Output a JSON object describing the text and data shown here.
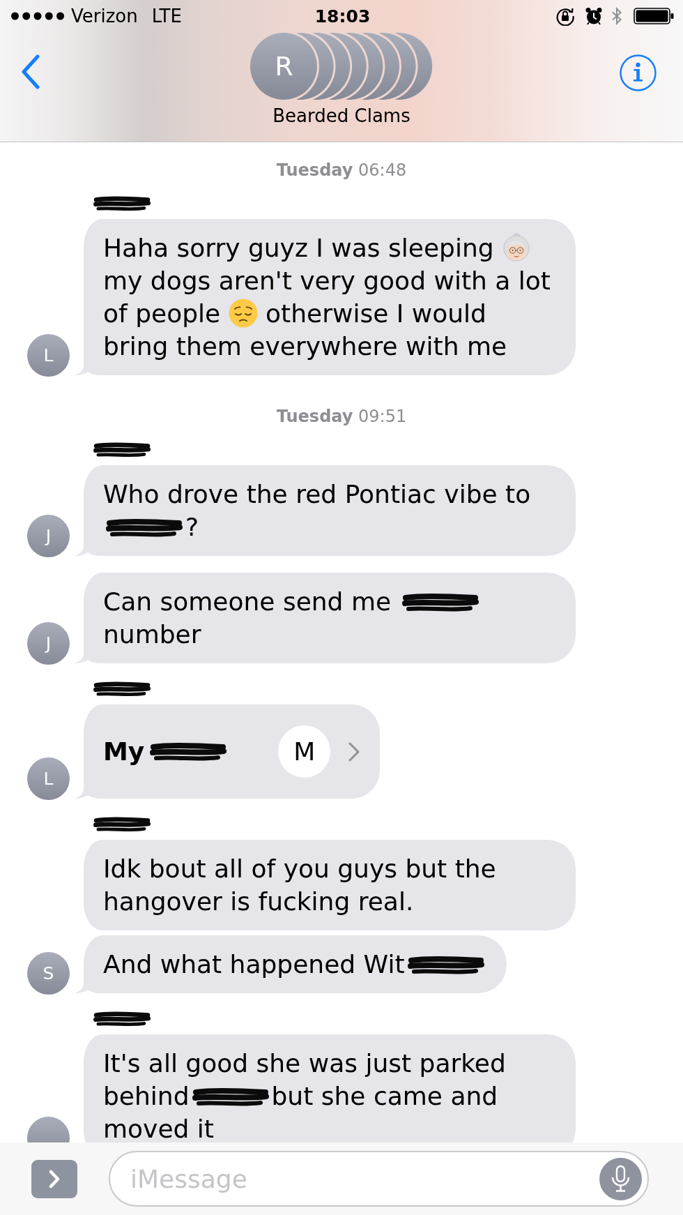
{
  "status_bar": {
    "carrier": "Verizon",
    "network": "LTE",
    "time": "18:03"
  },
  "header": {
    "avatars": [
      {
        "kind": "initial",
        "initial": "R"
      },
      {
        "kind": "blank"
      },
      {
        "kind": "blank"
      },
      {
        "kind": "blank"
      },
      {
        "kind": "blank"
      },
      {
        "kind": "blank"
      },
      {
        "kind": "blank"
      },
      {
        "kind": "blank"
      }
    ],
    "title": "Bearded Clams"
  },
  "thread": [
    {
      "kind": "timestamp",
      "text": "**Tuesday** 06:48"
    },
    {
      "kind": "group",
      "sender_redacted": true,
      "avatar": "L",
      "messages": [
        {
          "kind": "text",
          "tail": true,
          "parts": [
            {
              "kind": "text",
              "text": "Haha sorry guyz I was sleeping "
            },
            {
              "kind": "grandma"
            },
            {
              "kind": "text",
              "text": " my dogs aren't very good with a lot of people "
            },
            {
              "kind": "pensive"
            },
            {
              "kind": "text",
              "text": " otherwise I would bring them everywhere with me"
            }
          ]
        }
      ]
    },
    {
      "kind": "timestamp",
      "text": "**Tuesday** 09:51"
    },
    {
      "kind": "group",
      "sender_redacted": true,
      "avatar": "J",
      "messages": [
        {
          "kind": "text",
          "tail": true,
          "parts": [
            {
              "kind": "text",
              "text": "Who drove the red Pontiac vibe to "
            },
            {
              "kind": "redaction"
            },
            {
              "kind": "text",
              "text": "?"
            }
          ]
        }
      ]
    },
    {
      "kind": "group",
      "avatar": "J",
      "messages": [
        {
          "kind": "text",
          "tail": true,
          "parts": [
            {
              "kind": "text",
              "text": "Can someone send me "
            },
            {
              "kind": "redaction"
            },
            {
              "kind": "text",
              "text": " number"
            }
          ]
        }
      ]
    },
    {
      "kind": "group",
      "sender_redacted": true,
      "avatar": "L",
      "messages": [
        {
          "kind": "contact",
          "tail": true,
          "initial": "M",
          "parts": [
            {
              "kind": "text",
              "text": "My"
            },
            {
              "kind": "redaction"
            }
          ]
        }
      ]
    },
    {
      "kind": "group",
      "sender_redacted": true,
      "avatar": "S",
      "messages": [
        {
          "kind": "text",
          "tail": false,
          "parts": [
            {
              "kind": "text",
              "text": "Idk bout all of you guys but the hangover is fucking real."
            }
          ]
        },
        {
          "kind": "text",
          "tail": true,
          "parts": [
            {
              "kind": "text",
              "text": "And what happened Wit"
            },
            {
              "kind": "redaction"
            }
          ]
        }
      ]
    },
    {
      "kind": "group",
      "sender_redacted": true,
      "messages": [
        {
          "kind": "text",
          "parts": [
            {
              "kind": "text",
              "text": "It's all good she was just parked behind"
            },
            {
              "kind": "redaction"
            },
            {
              "kind": "text",
              "text": "but she came and moved it"
            }
          ]
        }
      ]
    }
  ],
  "composer": {
    "placeholder": "iMessage"
  }
}
